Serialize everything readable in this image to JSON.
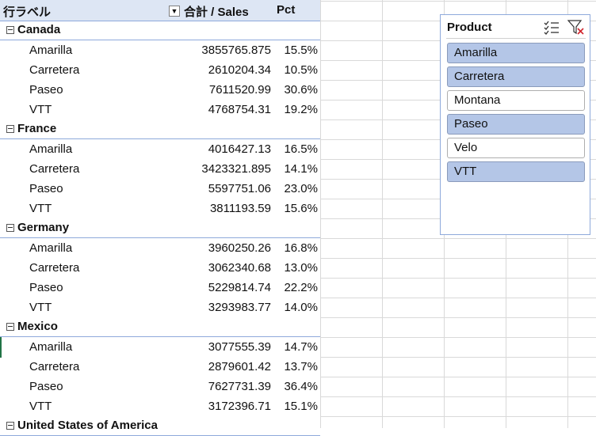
{
  "pivot": {
    "header": {
      "row_labels": "行ラベル",
      "sales": "合計 / Sales",
      "pct": "Pct"
    },
    "groups": [
      {
        "name": "Canada",
        "items": [
          {
            "name": "Amarilla",
            "sales": "3855765.875",
            "pct": "15.5%"
          },
          {
            "name": "Carretera",
            "sales": "2610204.34",
            "pct": "10.5%"
          },
          {
            "name": "Paseo",
            "sales": "7611520.99",
            "pct": "30.6%"
          },
          {
            "name": "VTT",
            "sales": "4768754.31",
            "pct": "19.2%"
          }
        ]
      },
      {
        "name": "France",
        "items": [
          {
            "name": "Amarilla",
            "sales": "4016427.13",
            "pct": "16.5%"
          },
          {
            "name": "Carretera",
            "sales": "3423321.895",
            "pct": "14.1%"
          },
          {
            "name": "Paseo",
            "sales": "5597751.06",
            "pct": "23.0%"
          },
          {
            "name": "VTT",
            "sales": "3811193.59",
            "pct": "15.6%"
          }
        ]
      },
      {
        "name": "Germany",
        "items": [
          {
            "name": "Amarilla",
            "sales": "3960250.26",
            "pct": "16.8%"
          },
          {
            "name": "Carretera",
            "sales": "3062340.68",
            "pct": "13.0%"
          },
          {
            "name": "Paseo",
            "sales": "5229814.74",
            "pct": "22.2%"
          },
          {
            "name": "VTT",
            "sales": "3293983.77",
            "pct": "14.0%"
          }
        ]
      },
      {
        "name": "Mexico",
        "items": [
          {
            "name": "Amarilla",
            "sales": "3077555.39",
            "pct": "14.7%"
          },
          {
            "name": "Carretera",
            "sales": "2879601.42",
            "pct": "13.7%"
          },
          {
            "name": "Paseo",
            "sales": "7627731.39",
            "pct": "36.4%"
          },
          {
            "name": "VTT",
            "sales": "3172396.71",
            "pct": "15.1%"
          }
        ]
      },
      {
        "name": "United States of America",
        "items": []
      }
    ]
  },
  "slicer": {
    "title": "Product",
    "multiselect_icon": "multi-select-icon",
    "clear_icon": "clear-filter-icon",
    "items": [
      {
        "label": "Amarilla",
        "selected": true
      },
      {
        "label": "Carretera",
        "selected": true
      },
      {
        "label": "Montana",
        "selected": false
      },
      {
        "label": "Paseo",
        "selected": true
      },
      {
        "label": "Velo",
        "selected": false
      },
      {
        "label": "VTT",
        "selected": true
      }
    ]
  },
  "colors": {
    "header_bg": "#dde6f4",
    "selected_item": "#b4c6e7",
    "accent_line": "#8ea9db"
  }
}
